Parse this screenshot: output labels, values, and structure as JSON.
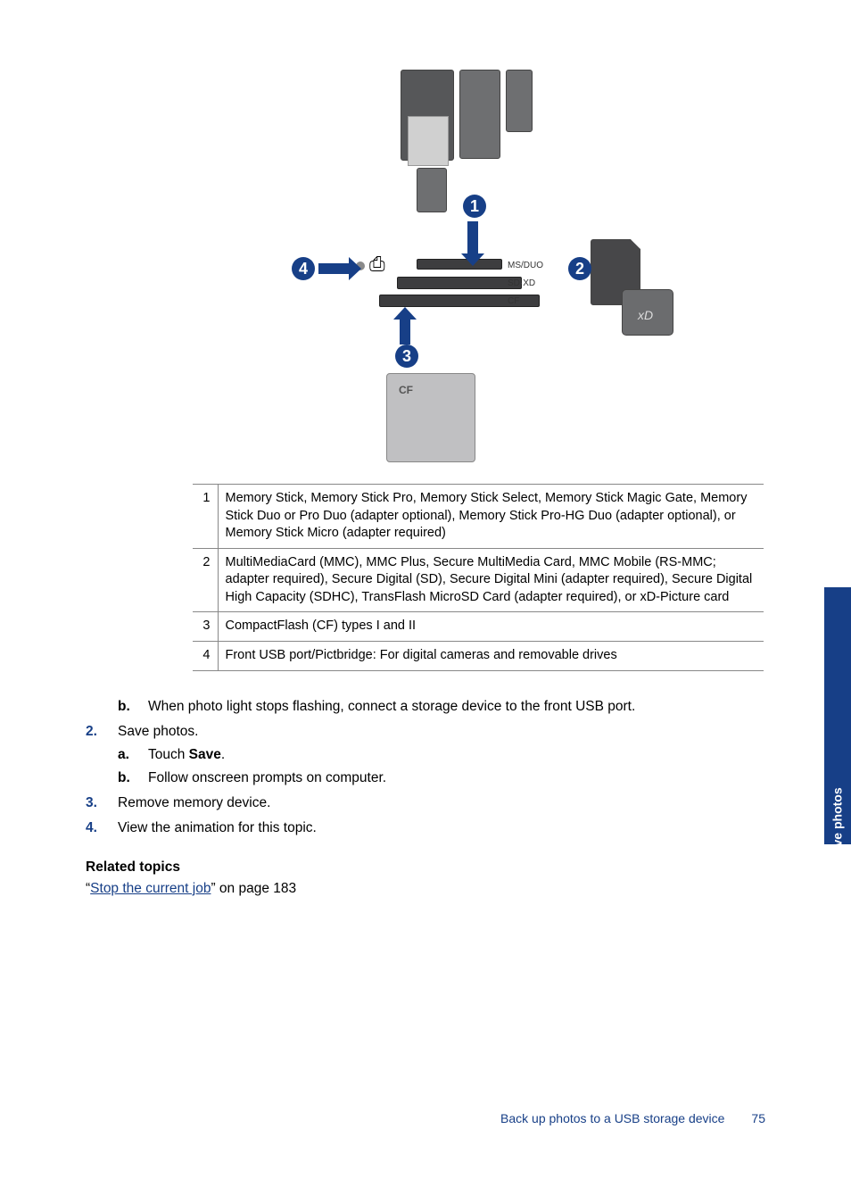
{
  "diagram": {
    "badges": {
      "b1": "1",
      "b2": "2",
      "b3": "3",
      "b4": "4"
    },
    "slot_labels": {
      "ms_duo": "MS/DUO",
      "sd_xd": "SD·XD",
      "cf": "CF"
    },
    "cf_card_label": "CF",
    "xd_card_label": "xD"
  },
  "legend": [
    {
      "num": "1",
      "text": "Memory Stick, Memory Stick Pro, Memory Stick Select, Memory Stick Magic Gate, Memory Stick Duo or Pro Duo (adapter optional), Memory Stick Pro-HG Duo (adapter optional), or Memory Stick Micro (adapter required)"
    },
    {
      "num": "2",
      "text": "MultiMediaCard (MMC), MMC Plus, Secure MultiMedia Card, MMC Mobile (RS-MMC; adapter required), Secure Digital (SD), Secure Digital Mini (adapter required), Secure Digital High Capacity (SDHC), TransFlash MicroSD Card (adapter required), or xD-Picture card"
    },
    {
      "num": "3",
      "text": "CompactFlash (CF) types I and II"
    },
    {
      "num": "4",
      "text": "Front USB port/Pictbridge: For digital cameras and removable drives"
    }
  ],
  "steps": {
    "s1b_text": "When photo light stops flashing, connect a storage device to the front USB port.",
    "s2_num": "2.",
    "s2_text": "Save photos.",
    "s2a_label": "a",
    "s2a_pre": "Touch ",
    "s2a_bold": "Save",
    "s2a_post": ".",
    "s2b_label": "b",
    "s2b_text": "Follow onscreen prompts on computer.",
    "s1b_label": "b",
    "s3_num": "3.",
    "s3_text": "Remove memory device.",
    "s4_num": "4.",
    "s4_text": "View the animation for this topic."
  },
  "related": {
    "heading": "Related topics",
    "link_text": "Stop the current job",
    "link_suffix": "” on page 183",
    "link_prefix": "“"
  },
  "side_tab": "Save photos",
  "footer": {
    "title": "Back up photos to a USB storage device",
    "page": "75"
  }
}
